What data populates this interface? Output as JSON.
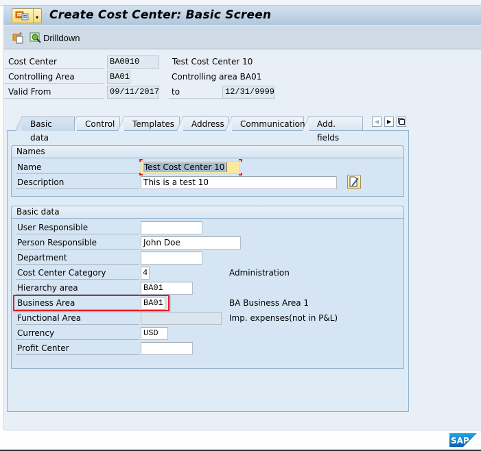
{
  "window": {
    "title": "Create Cost Center: Basic Screen",
    "menu_button_icon": "sap-menu-icon",
    "menu_button_arrow": "chevron-down-icon"
  },
  "toolbar": {
    "items": [
      {
        "icon": "create-copy-icon",
        "label": ""
      },
      {
        "icon": "drilldown-icon",
        "label": "Drilldown"
      }
    ]
  },
  "header": {
    "cost_center": {
      "label": "Cost Center",
      "value": "BA0010",
      "description": "Test Cost Center 10"
    },
    "controlling_area": {
      "label": "Controlling Area",
      "value": "BA01",
      "description": "Controlling area BA01"
    },
    "valid_from": {
      "label": "Valid From",
      "value": "09/11/2017",
      "to_label": "to",
      "to_value": "12/31/9999"
    }
  },
  "tabs": [
    {
      "label": "Basic data",
      "active": true
    },
    {
      "label": "Control",
      "active": false
    },
    {
      "label": "Templates",
      "active": false
    },
    {
      "label": "Address",
      "active": false
    },
    {
      "label": "Communication",
      "active": false
    },
    {
      "label": "Add. fields",
      "active": false
    }
  ],
  "tab_nav": {
    "prev": "◀",
    "next": "▶",
    "list": "tab-list-icon"
  },
  "names_group": {
    "title": "Names",
    "name": {
      "label": "Name",
      "value": "Test Cost Center 10"
    },
    "description": {
      "label": "Description",
      "value": "This is a test 10"
    }
  },
  "basic_group": {
    "title": "Basic data",
    "user_responsible": {
      "label": "User Responsible",
      "value": ""
    },
    "person_responsible": {
      "label": "Person Responsible",
      "value": "John Doe"
    },
    "department": {
      "label": "Department",
      "value": ""
    },
    "cost_center_category": {
      "label": "Cost Center Category",
      "value": "4",
      "description": "Administration"
    },
    "hierarchy_area": {
      "label": "Hierarchy area",
      "value": "BA01"
    },
    "business_area": {
      "label": "Business Area",
      "value": "BA01",
      "description": "BA Business Area 1"
    },
    "functional_area": {
      "label": "Functional Area",
      "value": "",
      "description": "Imp. expenses(not in P&L)"
    },
    "currency": {
      "label": "Currency",
      "value": "USD"
    },
    "profit_center": {
      "label": "Profit Center",
      "value": ""
    }
  },
  "footer": {
    "logo": "SAP"
  },
  "colors": {
    "highlight": "#e32024",
    "focused_field": "#fbe9a0",
    "panel": "#d5e5f3"
  }
}
